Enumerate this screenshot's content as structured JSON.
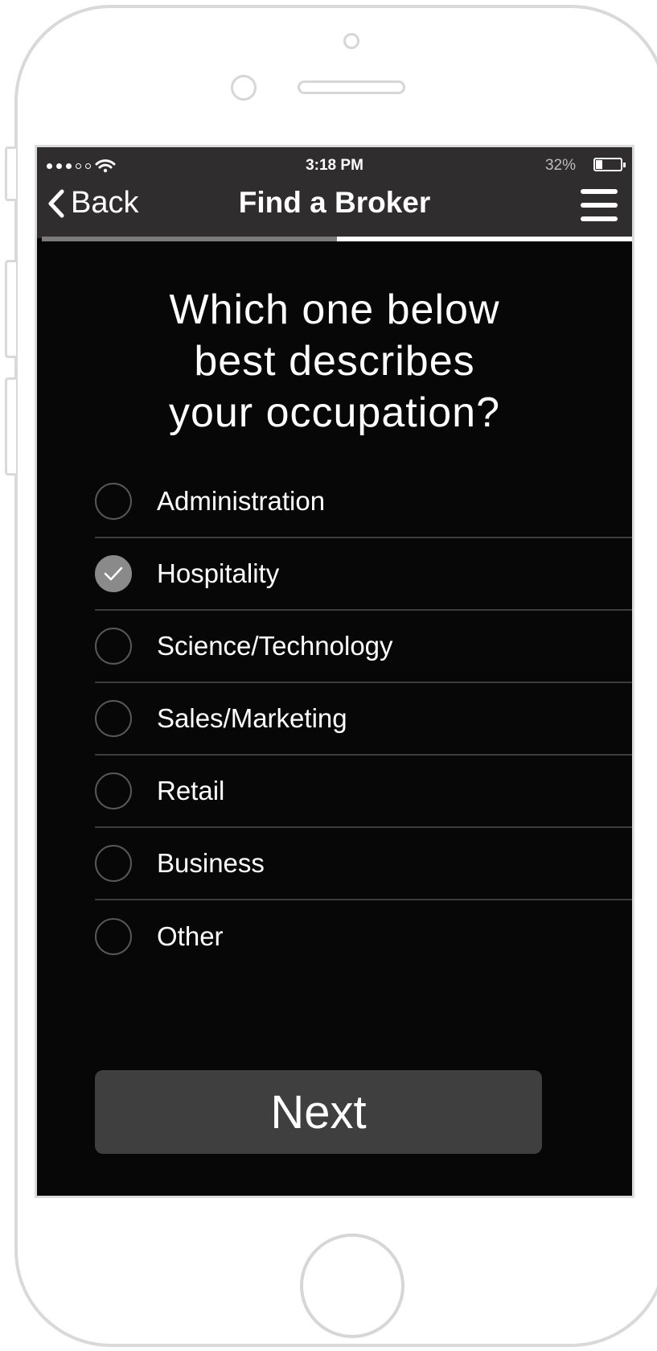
{
  "status": {
    "time": "3:18 PM",
    "battery": "32%",
    "battery_level": 0.32
  },
  "nav": {
    "back_label": "Back",
    "title": "Find a Broker"
  },
  "progress": {
    "value": 0.5
  },
  "question": {
    "line1": "Which one below",
    "line2": "best describes",
    "line3": "your occupation?"
  },
  "options": [
    {
      "label": "Administration",
      "checked": false
    },
    {
      "label": "Hospitality",
      "checked": true
    },
    {
      "label": "Science/Technology",
      "checked": false
    },
    {
      "label": "Sales/Marketing",
      "checked": false
    },
    {
      "label": "Retail",
      "checked": false
    },
    {
      "label": "Business",
      "checked": false
    },
    {
      "label": "Other",
      "checked": false
    }
  ],
  "next_label": "Next",
  "colors": {
    "background": "#070707",
    "navbar": "#2f2d2e",
    "button": "#3f3f3f",
    "checked": "#8a8a8a"
  }
}
